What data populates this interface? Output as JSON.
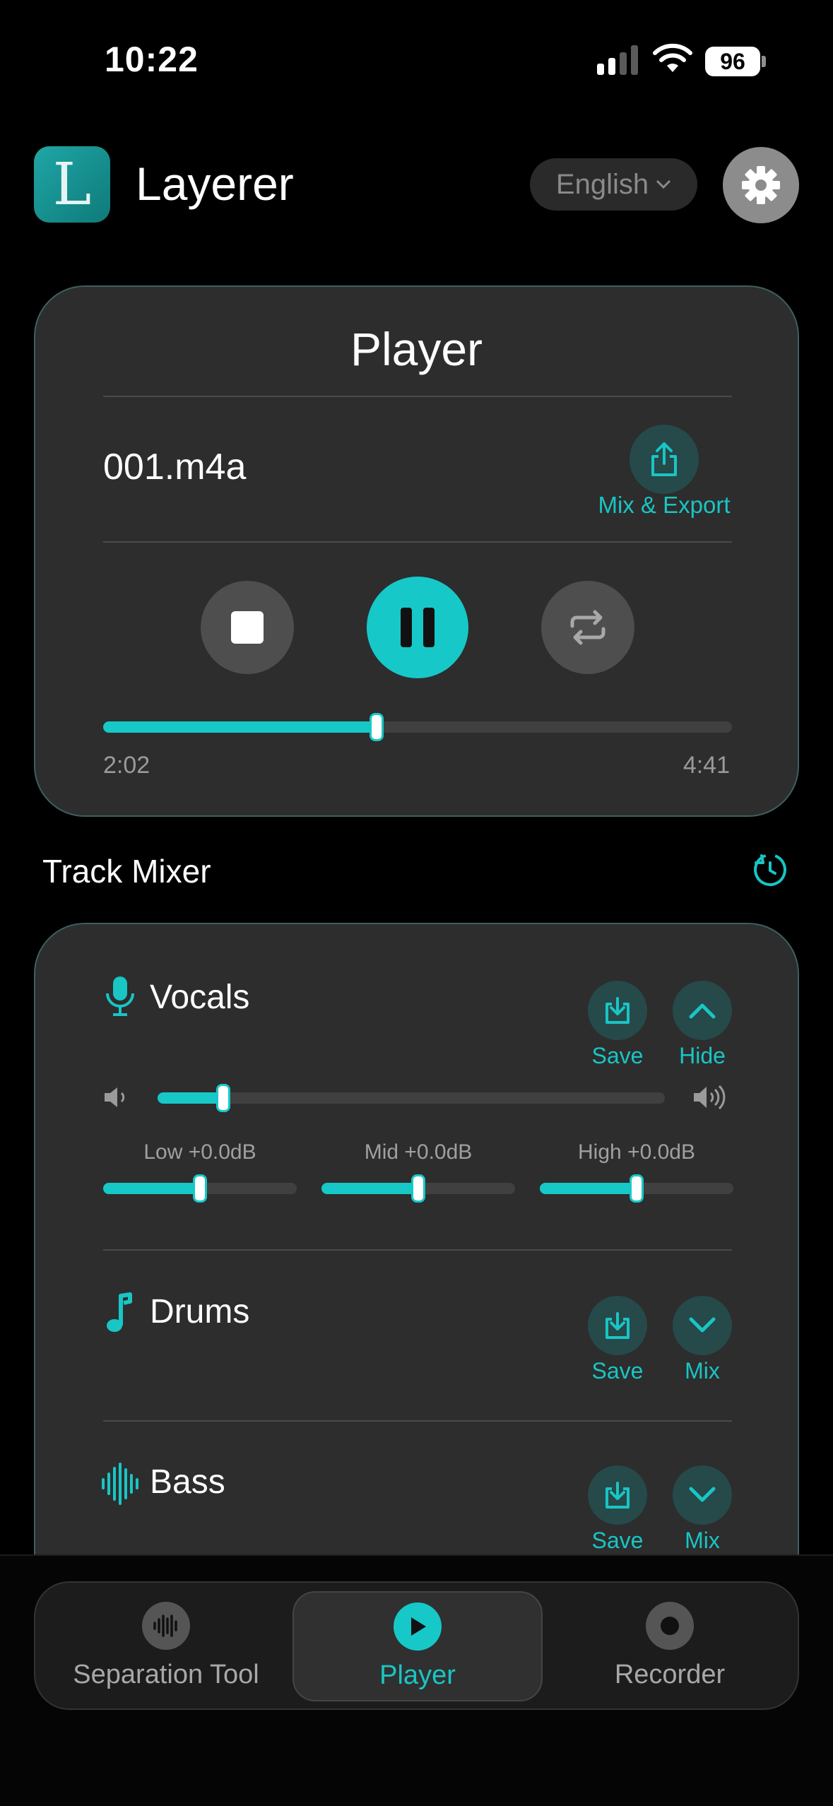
{
  "status_bar": {
    "time": "10:22",
    "battery": "96"
  },
  "header": {
    "app_name": "Layerer",
    "logo_letter": "L",
    "language": "English"
  },
  "player": {
    "title": "Player",
    "file_name": "001.m4a",
    "export_label": "Mix & Export",
    "elapsed": "2:02",
    "duration": "4:41",
    "progress": 0.435
  },
  "mixer": {
    "title": "Track Mixer",
    "tracks": [
      {
        "name": "Vocals",
        "icon": "microphone-icon",
        "save_label": "Save",
        "toggle_label": "Hide",
        "volume": 0.13,
        "eq": [
          {
            "label": "Low +0.0dB",
            "value": 0.5
          },
          {
            "label": "Mid +0.0dB",
            "value": 0.5
          },
          {
            "label": "High +0.0dB",
            "value": 0.5
          }
        ]
      },
      {
        "name": "Drums",
        "icon": "music-note-icon",
        "save_label": "Save",
        "toggle_label": "Mix"
      },
      {
        "name": "Bass",
        "icon": "waveform-icon",
        "save_label": "Save",
        "toggle_label": "Mix"
      }
    ]
  },
  "nav": {
    "tabs": [
      {
        "label": "Separation Tool",
        "active": false
      },
      {
        "label": "Player",
        "active": true
      },
      {
        "label": "Recorder",
        "active": false
      }
    ]
  },
  "colors": {
    "accent": "#17c8c8",
    "card": "#2d2d2d",
    "background": "#000000"
  }
}
